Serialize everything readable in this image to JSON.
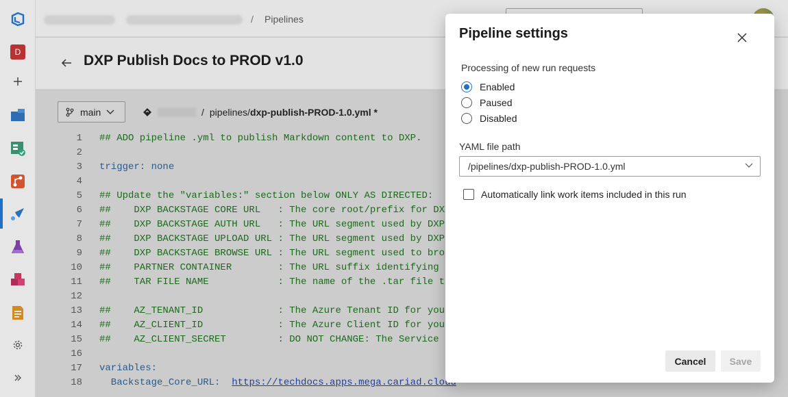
{
  "breadcrumb": {
    "separator": "/",
    "current": "Pipelines"
  },
  "rail": {
    "avatar_letter": "D",
    "icons": [
      "azure-devops-logo-icon",
      "project-avatar-icon",
      "add-icon",
      "overview-icon",
      "boards-icon",
      "repos-icon",
      "pipelines-icon",
      "test-plans-icon",
      "artifacts-icon",
      "wiki-icon",
      "settings-icon",
      "expand-icon"
    ]
  },
  "header": {
    "title": "DXP Publish Docs to PROD v1.0"
  },
  "editor": {
    "branch": "main",
    "path_separator": "/",
    "path_folder": "pipelines/",
    "path_file": "dxp-publish-PROD-1.0.yml",
    "path_modified": "*",
    "lines": [
      {
        "n": "1",
        "text": "## ADO pipeline .yml to publish Markdown content to DXP.",
        "kw": false
      },
      {
        "n": "2",
        "text": "",
        "kw": false
      },
      {
        "n": "3",
        "text": "trigger: none",
        "kw": true
      },
      {
        "n": "4",
        "text": "",
        "kw": false
      },
      {
        "n": "5",
        "text": "## Update the \"variables:\" section below ONLY AS DIRECTED:",
        "kw": false
      },
      {
        "n": "6",
        "text": "##    DXP BACKSTAGE CORE URL   : The core root/prefix for DX",
        "kw": false
      },
      {
        "n": "7",
        "text": "##    DXP BACKSTAGE AUTH URL   : The URL segment used by DXP",
        "kw": false
      },
      {
        "n": "8",
        "text": "##    DXP BACKSTAGE UPLOAD URL : The URL segment used by DXP",
        "kw": false
      },
      {
        "n": "9",
        "text": "##    DXP BACKSTAGE BROWSE URL : The URL segment used to bro",
        "kw": false
      },
      {
        "n": "10",
        "text": "##    PARTNER CONTAINER        : The URL suffix identifying",
        "kw": false
      },
      {
        "n": "11",
        "text": "##    TAR FILE NAME            : The name of the .tar file t",
        "kw": false
      },
      {
        "n": "12",
        "text": "",
        "kw": false
      },
      {
        "n": "13",
        "text": "##    AZ_TENANT_ID             : The Azure Tenant ID for you",
        "kw": false
      },
      {
        "n": "14",
        "text": "##    AZ_CLIENT_ID             : The Azure Client ID for you",
        "kw": false
      },
      {
        "n": "15",
        "text": "##    AZ_CLIENT_SECRET         : DO NOT CHANGE: The Service",
        "kw": false
      },
      {
        "n": "16",
        "text": "",
        "kw": false
      },
      {
        "n": "17",
        "text": "variables:",
        "kw": true
      },
      {
        "n": "18",
        "text": "  Backstage_Core_URL:  ",
        "kw": true
      }
    ],
    "line18_url": "https://techdocs.apps.mega.cariad.cloud"
  },
  "dialog": {
    "title": "Pipeline settings",
    "processing_label": "Processing of new run requests",
    "radios": [
      {
        "label": "Enabled",
        "selected": true
      },
      {
        "label": "Paused",
        "selected": false
      },
      {
        "label": "Disabled",
        "selected": false
      }
    ],
    "yaml_label": "YAML file path",
    "yaml_value": "/pipelines/dxp-publish-PROD-1.0.yml",
    "autolink_label": "Automatically link work items included in this run",
    "autolink_checked": false,
    "cancel_label": "Cancel",
    "save_label": "Save"
  },
  "colors": {
    "accent": "#1f6fc9",
    "code_comment": "#1b6a1b",
    "code_keyword": "#2a5a8a"
  }
}
